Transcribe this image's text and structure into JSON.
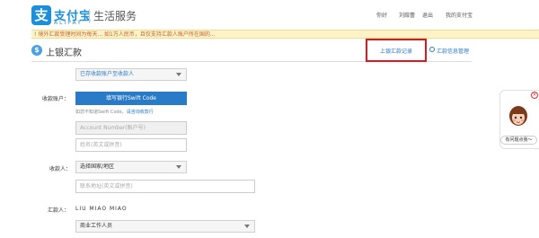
{
  "header": {
    "logo_glyph": "支",
    "brand": "支付宝",
    "brand_en": "ALIPAY",
    "service": "生活服务",
    "nav": [
      "你好",
      "刘葭蕾",
      "退出",
      "我的支付宝"
    ]
  },
  "notice": {
    "prefix": "!",
    "text": "境外汇款受理时间为每天... 如1万人民币，且仅支持汇款人账户所在国的..."
  },
  "page": {
    "title": "上银汇款",
    "history_link": "上银汇款记录",
    "manage_link": "汇款信息管理"
  },
  "form": {
    "account_select": "已存收款账户至收款人",
    "receiving_account_label": "收款账户：",
    "swift_button": "填写银行Swift Code",
    "hint_prefix": "如您不知道Swift Code，",
    "hint_link": "请咨询收款行",
    "account_number_placeholder": "Account Number(账户号)",
    "name_placeholder": "姓名(英文或拼音)",
    "payee_label": "收款人：",
    "country_select": "选择国家/地区",
    "address_placeholder": "联系地址(英文或拼音)",
    "remitter_label": "汇款人：",
    "remitter_name": "LIU MIAO MIAO",
    "occupation_select": "商业工作人员"
  },
  "side_widget": {
    "close": "×",
    "label": "有问题点我～"
  },
  "colors": {
    "brand_blue": "#1a8fdc",
    "link_blue": "#2a7bc7",
    "highlight_red": "#e4161c",
    "notice_bg": "#fdf3c7"
  }
}
